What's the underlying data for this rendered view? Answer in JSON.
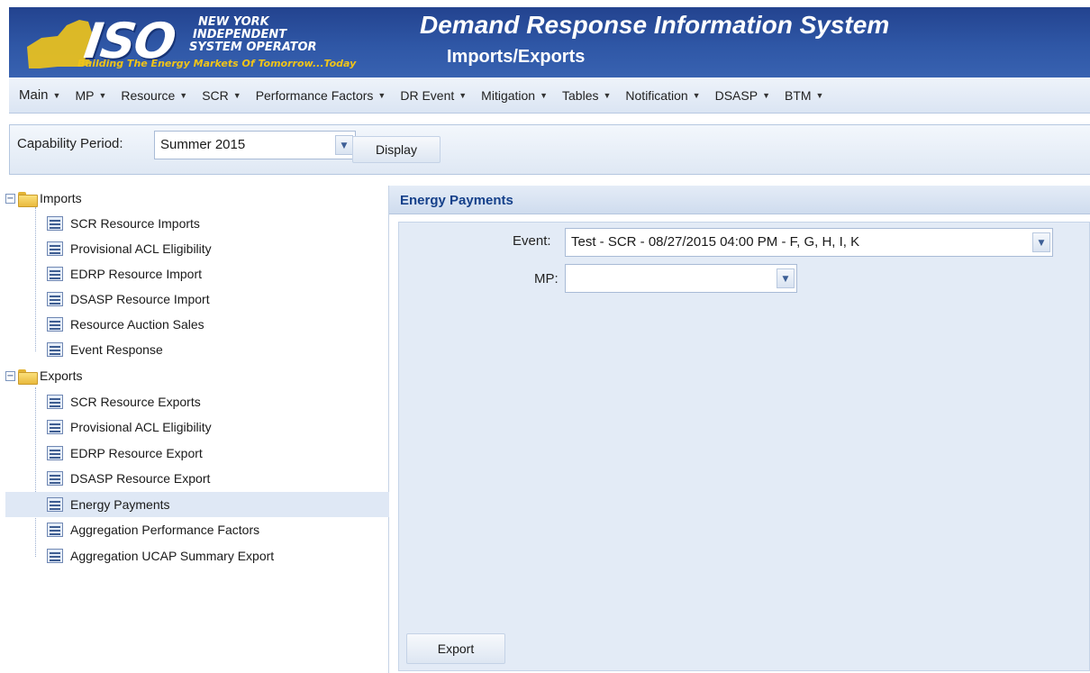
{
  "header": {
    "logo_mark": "ISO",
    "logo_org_lines": [
      "NEW YORK",
      "INDEPENDENT",
      "SYSTEM OPERATOR"
    ],
    "logo_tagline": "Building The Energy Markets Of Tomorrow...Today",
    "app_title": "Demand Response Information System",
    "page_subtitle": "Imports/Exports"
  },
  "menu": {
    "items": [
      {
        "label": "Main"
      },
      {
        "label": "MP"
      },
      {
        "label": "Resource"
      },
      {
        "label": "SCR"
      },
      {
        "label": "Performance Factors"
      },
      {
        "label": "DR Event"
      },
      {
        "label": "Mitigation"
      },
      {
        "label": "Tables"
      },
      {
        "label": "Notification"
      },
      {
        "label": "DSASP"
      },
      {
        "label": "BTM"
      }
    ]
  },
  "capability": {
    "label": "Capability Period:",
    "selected": "Summer 2015",
    "display_button": "Display"
  },
  "tree": {
    "imports": {
      "label": "Imports",
      "items": [
        "SCR Resource Imports",
        "Provisional ACL Eligibility",
        "EDRP Resource Import",
        "DSASP Resource Import",
        "Resource Auction Sales",
        "Event Response"
      ]
    },
    "exports": {
      "label": "Exports",
      "items": [
        "SCR Resource Exports",
        "Provisional ACL Eligibility",
        "EDRP Resource Export",
        "DSASP Resource Export",
        "Energy Payments",
        "Aggregation Performance Factors",
        "Aggregation UCAP Summary Export"
      ]
    },
    "selected_item": "Energy Payments"
  },
  "panel": {
    "title": "Energy Payments",
    "event_label": "Event:",
    "event_value": "Test - SCR - 08/27/2015 04:00 PM - F, G, H, I, K",
    "mp_label": "MP:",
    "mp_value": "",
    "export_button": "Export"
  },
  "colors": {
    "header_blue": "#2f57a6",
    "accent_gold": "#f0c419",
    "panel_title": "#15408a"
  },
  "icons": {
    "dropdown": "chevron-down-icon",
    "folder": "folder-icon",
    "page": "page-icon",
    "collapse": "collapse-icon"
  }
}
